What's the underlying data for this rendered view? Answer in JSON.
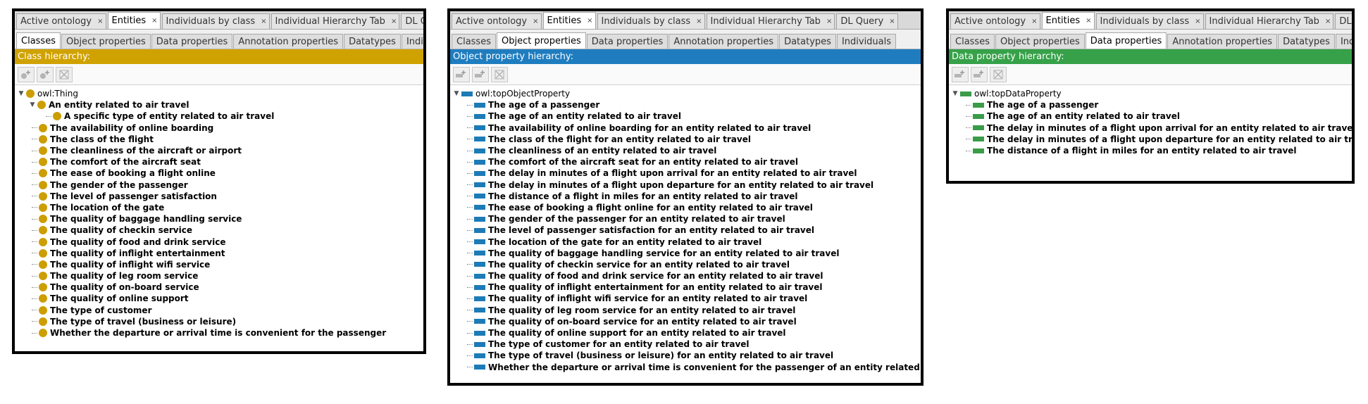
{
  "colors": {
    "class": "#d0a200",
    "object": "#1f7dbf",
    "data": "#36a149"
  },
  "top_tabs": [
    "Active ontology",
    "Entities",
    "Individuals by class",
    "Individual Hierarchy Tab",
    "DL Query"
  ],
  "sub_tabs": [
    "Classes",
    "Object properties",
    "Data properties",
    "Annotation properties",
    "Datatypes",
    "Individuals"
  ],
  "class_panel": {
    "header": "Class hierarchy:",
    "root": "owl:Thing",
    "child": "An entity related to air travel",
    "grandchild": "A specific type of entity related to air travel",
    "items": [
      "The availability of online boarding",
      "The class of the flight",
      "The cleanliness of the aircraft or airport",
      "The comfort of the aircraft seat",
      "The ease of booking a flight online",
      "The gender of the passenger",
      "The level of passenger satisfaction",
      "The location of the gate",
      "The quality of baggage handling service",
      "The quality of checkin service",
      "The quality of food and drink service",
      "The quality of inflight entertainment",
      "The quality of inflight wifi service",
      "The quality of leg room service",
      "The quality of on-board service",
      "The quality of online support",
      "The type of customer",
      "The type of travel (business or leisure)",
      "Whether the departure or arrival time is convenient for the passenger"
    ]
  },
  "object_panel": {
    "header": "Object property hierarchy:",
    "root": "owl:topObjectProperty",
    "items": [
      "The age of a passenger",
      "The age of an entity related to air travel",
      "The availability of online boarding for an entity related to air travel",
      "The class of the flight for an entity related to air travel",
      "The cleanliness of an entity related to air travel",
      "The comfort of the aircraft seat for an entity related to air travel",
      "The delay in minutes of a flight upon arrival for an entity related to air travel",
      "The delay in minutes of a flight upon departure for an entity related to air travel",
      "The distance of a flight in miles for an entity related to air travel",
      "The ease of booking a flight online for an entity related to air travel",
      "The gender of the passenger for an entity related to air travel",
      "The level of passenger satisfaction for an entity related to air travel",
      "The location of the gate for an entity related to air travel",
      "The quality of baggage handling service for an entity related to air travel",
      "The quality of checkin service for an entity related to air travel",
      "The quality of food and drink service for an entity related to air travel",
      "The quality of inflight entertainment for an entity related to air travel",
      "The quality of inflight wifi service for an entity related to air travel",
      "The quality of leg room service for an entity related to air travel",
      "The quality of on-board service for an entity related to air travel",
      "The quality of online support for an entity related to air travel",
      "The type of customer for an entity related to air travel",
      "The type of travel (business or leisure) for an entity related to air travel",
      "Whether the departure or arrival time is convenient for the passenger of an entity related to air travel"
    ]
  },
  "data_panel": {
    "header": "Data property hierarchy:",
    "root": "owl:topDataProperty",
    "items": [
      "The age of a passenger",
      "The age of an entity related to air travel",
      "The delay in minutes of a flight upon arrival for an entity related to air travel",
      "The delay in minutes of a flight upon departure for an entity related to air travel",
      "The distance of a flight in miles for an entity related to air travel"
    ]
  }
}
